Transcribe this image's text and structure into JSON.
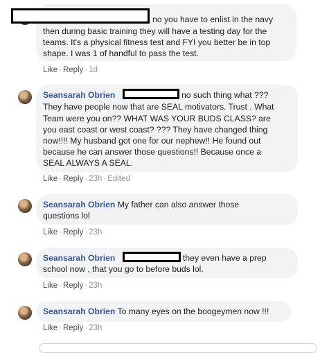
{
  "comments": [
    {
      "author": "",
      "text": "no you have to enlist in the navy then during basic training they will have a testing day for the teams. It's a physical fitness test and FYI you better be in top shape. I was 1 of handful to pass the test.",
      "line1": "no you have to enlist in the navy",
      "line2": "then during basic training they will have a testing day for the",
      "line3": "teams. It's a physical fitness test and FYI you better be in top",
      "line4": "shape. I was 1 of handful to pass the test.",
      "like": "Like",
      "reply": "Reply",
      "time": "1d"
    },
    {
      "author": "Seansarah Obrien",
      "line1": "no such thing what ???",
      "line2": "They have people now that are SEAL motivators. Trust . What",
      "line3": "Team were you on?? WHAT WAS YOUR BUDS CLASS? are",
      "line4": "you east coast or west coast? ??? They have changed thing",
      "line5": "now!!!! My husband got one for our nephew!! He found out",
      "line6": "because he can answer those questions!! Because once a",
      "line7": "SEAL ALWAYS A SEAL.",
      "like": "Like",
      "reply": "Reply",
      "time": "23h",
      "edited": "Edited"
    },
    {
      "author": "Seansarah Obrien",
      "line1": "My father can also answer those",
      "line2": "questions lol",
      "like": "Like",
      "reply": "Reply",
      "time": "23h"
    },
    {
      "author": "Seansarah Obrien",
      "line1": "they even have a prep",
      "line2": "school now , that you go to before buds lol.",
      "like": "Like",
      "reply": "Reply",
      "time": "23h"
    },
    {
      "author": "Seansarah Obrien",
      "line1": "To many eyes on the boogeymen now !!!",
      "like": "Like",
      "reply": "Reply",
      "time": "23h"
    }
  ],
  "separator": "·",
  "colors": {
    "bubble": "#f2f3f5",
    "author": "#385898",
    "meta": "#90949c",
    "redaction": "#000000"
  },
  "icons": {
    "avatar": "profile-photo"
  }
}
